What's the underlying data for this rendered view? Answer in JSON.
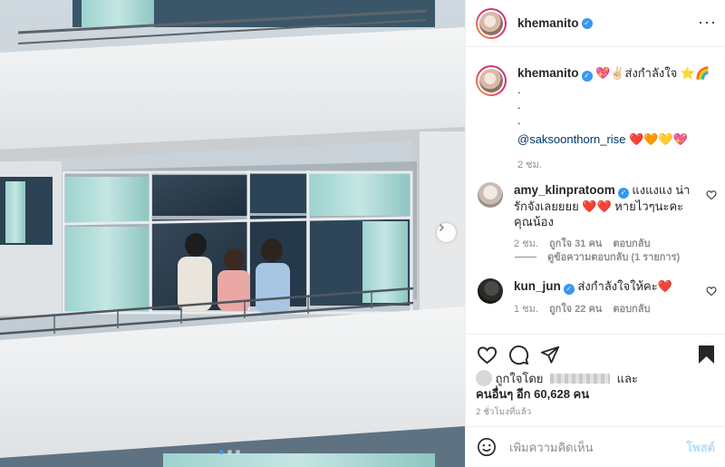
{
  "post": {
    "author": "khemanito",
    "caption_lines": [
      "💖✌🏻ส่งกำลังใจ ⭐️🌈",
      ".",
      ".",
      "."
    ],
    "caption_mention": "@saksoonthorn_rise",
    "caption_mention_suffix": " ❤️🧡💛💖",
    "caption_time": "2 ชม."
  },
  "header": {
    "username": "khemanito",
    "more_icon": "more-options-icon"
  },
  "comments": [
    {
      "username": "amy_klinpratoom",
      "text": "แงแงแง น่ารักจังเลยยยย ❤️❤️ หายไวๆนะคะคุณน้อง",
      "time": "2 ชม.",
      "likes": "ถูกใจ 31 คน",
      "reply": "ตอบกลับ",
      "view_replies": "ดูข้อความตอบกลับ (1 รายการ)"
    },
    {
      "username": "kun_jun",
      "text": "ส่งกำลังใจให้คะ❤️",
      "time": "1 ชม.",
      "likes": "ถูกใจ 22 คน",
      "reply": "ตอบกลับ"
    }
  ],
  "likes": {
    "prefix": "ถูกใจโดย",
    "suffix": "และ",
    "others": "คนอื่นๆ อีก 60,628 คน"
  },
  "post_time": "2 ชั่วโมงที่แล้ว",
  "add_comment": {
    "placeholder": "เพิ่มความคิดเห็น",
    "post_label": "โพสต์"
  },
  "carousel": {
    "current": 1,
    "total": 3
  },
  "colors": {
    "verified": "#3897f0",
    "mention": "#00376b",
    "post_disabled": "#b2dffc"
  }
}
